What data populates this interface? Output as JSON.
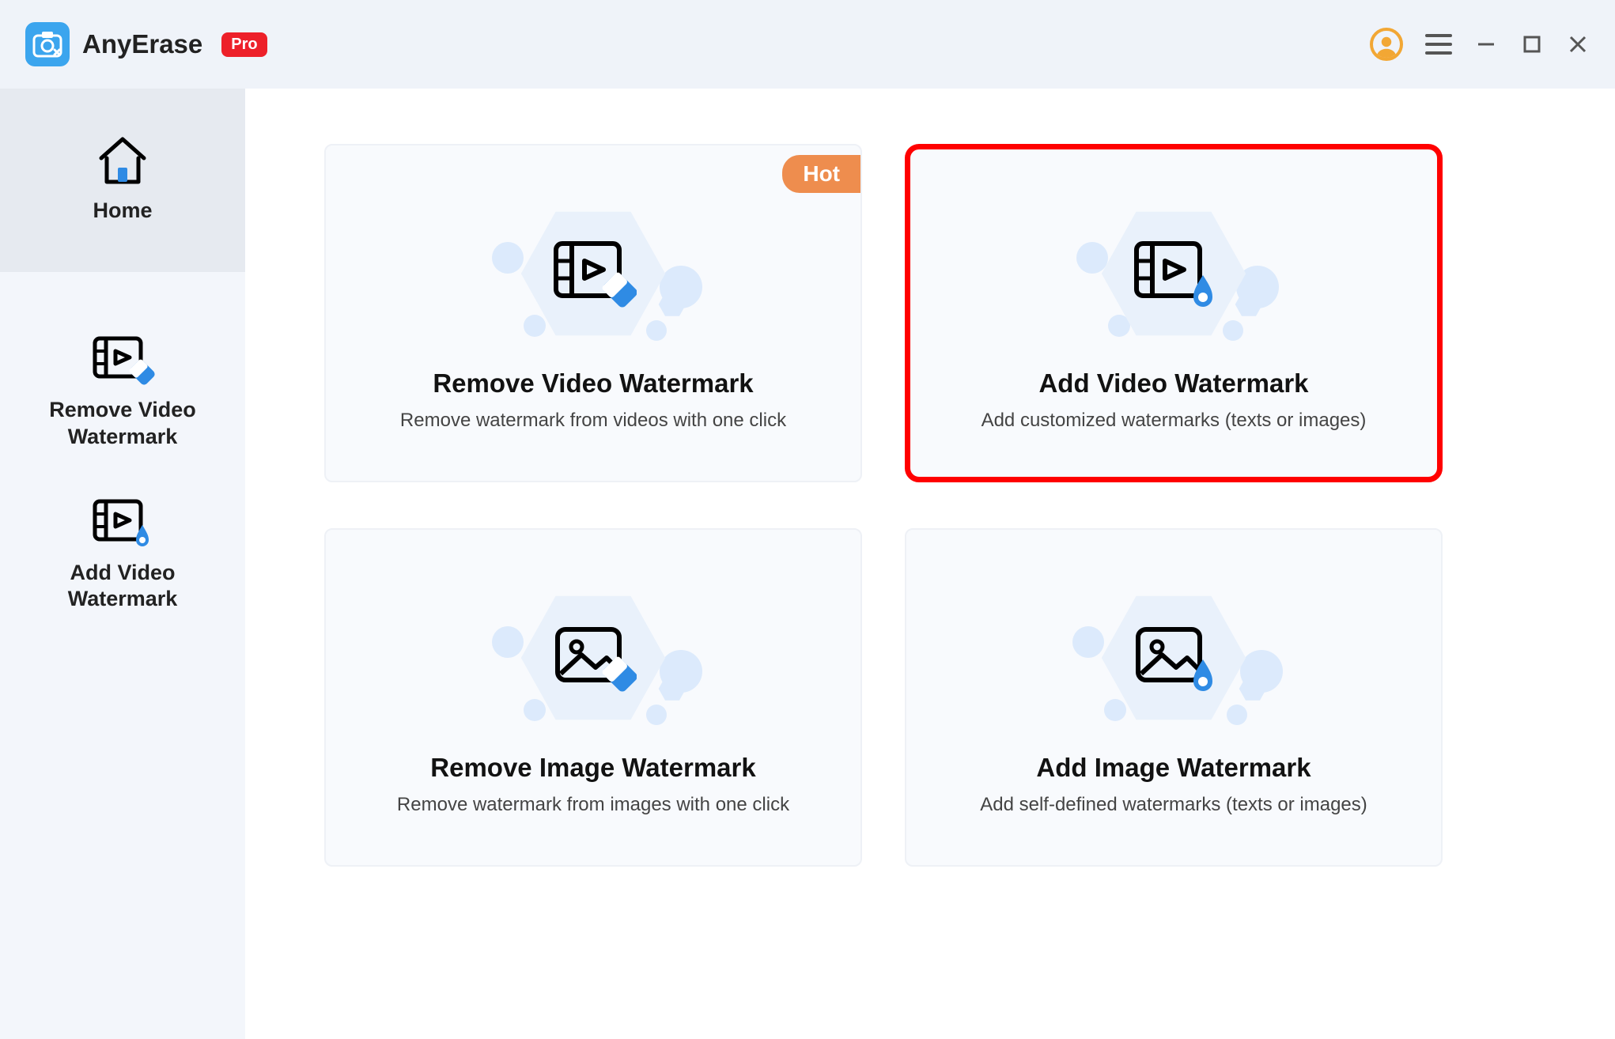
{
  "app": {
    "name": "AnyErase",
    "badge": "Pro"
  },
  "titlebar_icons": {
    "user": "user-icon",
    "menu": "menu-icon",
    "minimize": "minimize-icon",
    "maximize": "maximize-icon",
    "close": "close-icon"
  },
  "sidebar": {
    "items": [
      {
        "label": "Home",
        "active": true
      },
      {
        "label": "Remove Video\nWatermark",
        "active": false
      },
      {
        "label": "Add Video\nWatermark",
        "active": false
      }
    ]
  },
  "cards": [
    {
      "title": "Remove Video Watermark",
      "subtitle": "Remove watermark from videos with one click",
      "hot": "Hot",
      "highlight": false,
      "icon": "video-eraser"
    },
    {
      "title": "Add Video Watermark",
      "subtitle": "Add customized watermarks (texts or images)",
      "hot": "",
      "highlight": true,
      "icon": "video-droplet"
    },
    {
      "title": "Remove Image Watermark",
      "subtitle": "Remove watermark from images with one click",
      "hot": "",
      "highlight": false,
      "icon": "image-eraser"
    },
    {
      "title": "Add Image Watermark",
      "subtitle": "Add self-defined watermarks  (texts or images)",
      "hot": "",
      "highlight": false,
      "icon": "image-droplet"
    }
  ],
  "colors": {
    "bg_soft": "#f8fafd",
    "sidebar": "#f3f6fb",
    "titlebar": "#eff3f9",
    "accent_blue": "#3ba5ee",
    "accent_orange": "#ee8d4e",
    "badge_red": "#ed2029",
    "user_orange": "#f2a734",
    "highlight_red": "#ff0000"
  }
}
